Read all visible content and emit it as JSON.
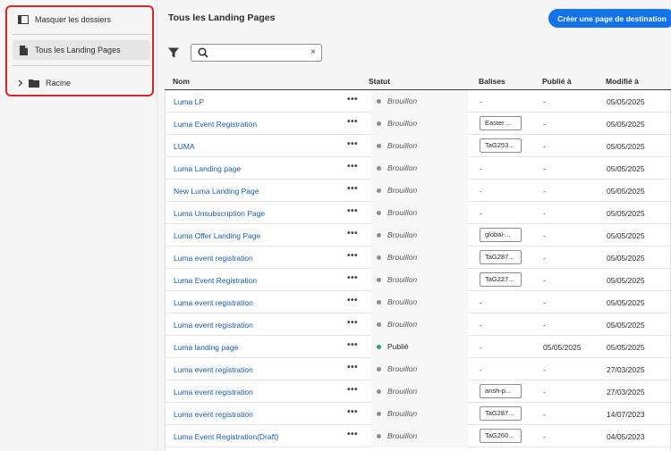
{
  "sidebar": {
    "hide_folders": "Masquer les dossiers",
    "all_pages": "Tous les Landing Pages",
    "root": "Racine"
  },
  "header": {
    "title": "Tous les Landing Pages",
    "create_button": "Créer une page de destination"
  },
  "search": {
    "value": "",
    "clear": "×"
  },
  "table": {
    "columns": [
      "Nom",
      "Statut",
      "Balises",
      "Publié à",
      "Modifié à"
    ],
    "more": "•••",
    "rows": [
      {
        "name": "Luma LP",
        "status": "Brouillon",
        "published": false,
        "tag": "-",
        "tag_is_chip": false,
        "pub": "-",
        "mod": "05/05/2025"
      },
      {
        "name": "Luma Event Registration",
        "status": "Brouillon",
        "published": false,
        "tag": "Easter ...",
        "tag_is_chip": true,
        "pub": "-",
        "mod": "05/05/2025"
      },
      {
        "name": "LUMA",
        "status": "Brouillon",
        "published": false,
        "tag": "TaG253...",
        "tag_is_chip": true,
        "pub": "-",
        "mod": "05/05/2025"
      },
      {
        "name": "Luma Landing page",
        "status": "Brouillon",
        "published": false,
        "tag": "-",
        "tag_is_chip": false,
        "pub": "-",
        "mod": "05/05/2025"
      },
      {
        "name": "New Luma Landing Page",
        "status": "Brouillon",
        "published": false,
        "tag": "-",
        "tag_is_chip": false,
        "pub": "-",
        "mod": "05/05/2025"
      },
      {
        "name": "Luma Unsubscription Page",
        "status": "Brouillon",
        "published": false,
        "tag": "-",
        "tag_is_chip": false,
        "pub": "-",
        "mod": "05/05/2025"
      },
      {
        "name": "Luma Offer Landing Page",
        "status": "Brouillon",
        "published": false,
        "tag": "global-...",
        "tag_is_chip": true,
        "pub": "-",
        "mod": "05/05/2025"
      },
      {
        "name": "Luma event registration",
        "status": "Brouillon",
        "published": false,
        "tag": "TaG287...",
        "tag_is_chip": true,
        "pub": "-",
        "mod": "05/05/2025"
      },
      {
        "name": "Luma Event Registration",
        "status": "Brouillon",
        "published": false,
        "tag": "TaG227...",
        "tag_is_chip": true,
        "pub": "-",
        "mod": "05/05/2025"
      },
      {
        "name": "Luma event registration",
        "status": "Brouillon",
        "published": false,
        "tag": "-",
        "tag_is_chip": false,
        "pub": "-",
        "mod": "05/05/2025"
      },
      {
        "name": "Luma event registration",
        "status": "Brouillon",
        "published": false,
        "tag": "-",
        "tag_is_chip": false,
        "pub": "-",
        "mod": "05/05/2025"
      },
      {
        "name": "Luma landing page",
        "status": "Publié",
        "published": true,
        "tag": "-",
        "tag_is_chip": false,
        "pub": "05/05/2025",
        "mod": "05/05/2025"
      },
      {
        "name": "Luma event registration",
        "status": "Brouillon",
        "published": false,
        "tag": "-",
        "tag_is_chip": false,
        "pub": "-",
        "mod": "27/03/2025"
      },
      {
        "name": "Luma event registration",
        "status": "Brouillon",
        "published": false,
        "tag": "ansh-p...",
        "tag_is_chip": true,
        "pub": "-",
        "mod": "27/03/2025"
      },
      {
        "name": "Luma event registration",
        "status": "Brouillon",
        "published": false,
        "tag": "TaG287...",
        "tag_is_chip": true,
        "pub": "-",
        "mod": "14/07/2023"
      },
      {
        "name": "Luma Event Registration(Draft)",
        "status": "Brouillon",
        "published": false,
        "tag": "TaG260...",
        "tag_is_chip": true,
        "pub": "-",
        "mod": "04/05/2023"
      }
    ]
  },
  "colors": {
    "accent": "#1473e6",
    "link": "#1a5fb4",
    "highlight_border": "#d7262b",
    "published_dot": "#2d9d78",
    "draft_dot": "#8e8e8e"
  }
}
